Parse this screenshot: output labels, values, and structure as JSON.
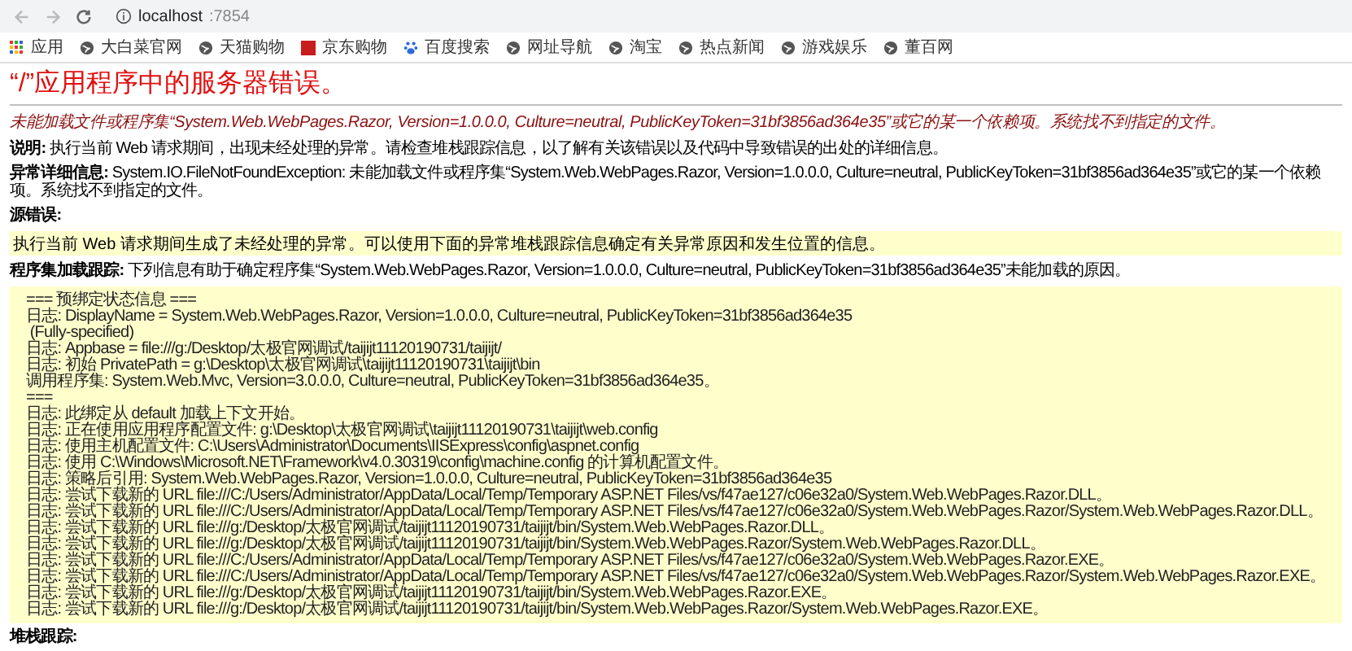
{
  "browser": {
    "url_host": "localhost",
    "url_port": ":7854",
    "bookmarks": [
      {
        "kind": "apps",
        "label": "应用"
      },
      {
        "kind": "globe",
        "label": "大白菜官网"
      },
      {
        "kind": "globe",
        "label": "天猫购物"
      },
      {
        "kind": "square",
        "label": "京东购物"
      },
      {
        "kind": "paw",
        "label": "百度搜索"
      },
      {
        "kind": "globe",
        "label": "网址导航"
      },
      {
        "kind": "globe",
        "label": "淘宝"
      },
      {
        "kind": "globe",
        "label": "热点新闻"
      },
      {
        "kind": "globe",
        "label": "游戏娱乐"
      },
      {
        "kind": "globe",
        "label": "董百网"
      }
    ]
  },
  "page": {
    "title": "“/”应用程序中的服务器错误。",
    "subtitle": "未能加载文件或程序集“System.Web.WebPages.Razor, Version=1.0.0.0, Culture=neutral, PublicKeyToken=31bf3856ad364e35”或它的某一个依赖项。系统找不到指定的文件。",
    "description": {
      "label": "说明:",
      "text": "执行当前 Web 请求期间，出现未经处理的异常。请检查堆栈跟踪信息，以了解有关该错误以及代码中导致错误的出处的详细信息。"
    },
    "exception_details": {
      "label": "异常详细信息:",
      "text": "System.IO.FileNotFoundException: 未能加载文件或程序集“System.Web.WebPages.Razor, Version=1.0.0.0, Culture=neutral, PublicKeyToken=31bf3856ad364e35”或它的某一个依赖项。系统找不到指定的文件。"
    },
    "source_error": {
      "label": "源错误:",
      "box_text": "执行当前 Web 请求期间生成了未经处理的异常。可以使用下面的异常堆栈跟踪信息确定有关异常原因和发生位置的信息。"
    },
    "assembly_trace": {
      "label": "程序集加载跟踪:",
      "text": "下列信息有助于确定程序集“System.Web.WebPages.Razor, Version=1.0.0.0, Culture=neutral, PublicKeyToken=31bf3856ad364e35”未能加载的原因。"
    },
    "log_lines": [
      "=== 预绑定状态信息 ===",
      "日志: DisplayName = System.Web.WebPages.Razor, Version=1.0.0.0, Culture=neutral, PublicKeyToken=31bf3856ad364e35",
      " (Fully-specified)",
      "日志: Appbase = file:///g:/Desktop/太极官网调试/taijijt11120190731/taijijt/",
      "日志: 初始 PrivatePath = g:\\Desktop\\太极官网调试\\taijijt11120190731\\taijijt\\bin",
      "调用程序集: System.Web.Mvc, Version=3.0.0.0, Culture=neutral, PublicKeyToken=31bf3856ad364e35。",
      "===",
      "日志: 此绑定从 default 加载上下文开始。",
      "日志: 正在使用应用程序配置文件: g:\\Desktop\\太极官网调试\\taijijt11120190731\\taijijt\\web.config",
      "日志: 使用主机配置文件: C:\\Users\\Administrator\\Documents\\IISExpress\\config\\aspnet.config",
      "日志: 使用 C:\\Windows\\Microsoft.NET\\Framework\\v4.0.30319\\config\\machine.config 的计算机配置文件。",
      "日志: 策略后引用: System.Web.WebPages.Razor, Version=1.0.0.0, Culture=neutral, PublicKeyToken=31bf3856ad364e35",
      "日志: 尝试下载新的 URL file:///C:/Users/Administrator/AppData/Local/Temp/Temporary ASP.NET Files/vs/f47ae127/c06e32a0/System.Web.WebPages.Razor.DLL。",
      "日志: 尝试下载新的 URL file:///C:/Users/Administrator/AppData/Local/Temp/Temporary ASP.NET Files/vs/f47ae127/c06e32a0/System.Web.WebPages.Razor/System.Web.WebPages.Razor.DLL。",
      "日志: 尝试下载新的 URL file:///g:/Desktop/太极官网调试/taijijt11120190731/taijijt/bin/System.Web.WebPages.Razor.DLL。",
      "日志: 尝试下载新的 URL file:///g:/Desktop/太极官网调试/taijijt11120190731/taijijt/bin/System.Web.WebPages.Razor/System.Web.WebPages.Razor.DLL。",
      "日志: 尝试下载新的 URL file:///C:/Users/Administrator/AppData/Local/Temp/Temporary ASP.NET Files/vs/f47ae127/c06e32a0/System.Web.WebPages.Razor.EXE。",
      "日志: 尝试下载新的 URL file:///C:/Users/Administrator/AppData/Local/Temp/Temporary ASP.NET Files/vs/f47ae127/c06e32a0/System.Web.WebPages.Razor/System.Web.WebPages.Razor.EXE。",
      "日志: 尝试下载新的 URL file:///g:/Desktop/太极官网调试/taijijt11120190731/taijijt/bin/System.Web.WebPages.Razor.EXE。",
      "日志: 尝试下载新的 URL file:///g:/Desktop/太极官网调试/taijijt11120190731/taijijt/bin/System.Web.WebPages.Razor/System.Web.WebPages.Razor.EXE。"
    ],
    "stack_trace": {
      "label": "堆栈跟踪:"
    }
  }
}
